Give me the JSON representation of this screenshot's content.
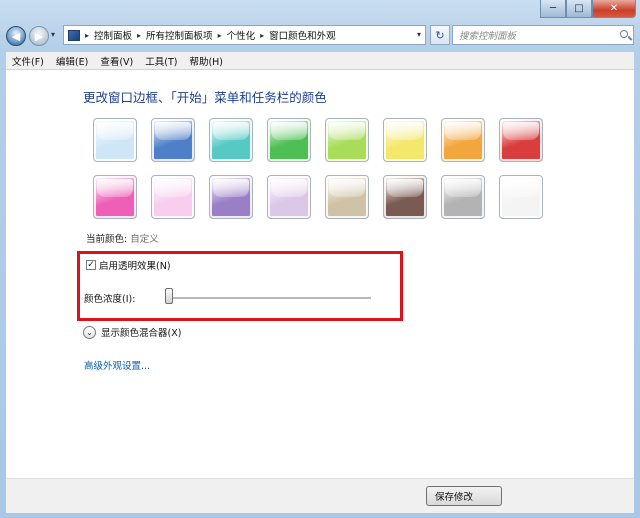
{
  "caption": {
    "minimize": "─",
    "maximize": "□",
    "close": "✕"
  },
  "nav": {
    "back": "◀",
    "forward": "▶",
    "history": "▾",
    "breadcrumbs": [
      "控制面板",
      "所有控制面板项",
      "个性化",
      "窗口颜色和外观"
    ],
    "breadcrumb_sep": "▸",
    "dropdown": "▾",
    "refresh": "↻",
    "search_placeholder": "搜索控制面板"
  },
  "menu": [
    "文件(F)",
    "编辑(E)",
    "查看(V)",
    "工具(T)",
    "帮助(H)"
  ],
  "page_title": "更改窗口边框、「开始」菜单和任务栏的颜色",
  "swatches": [
    {
      "name": "sky",
      "color": "#cfe6f7"
    },
    {
      "name": "twilight",
      "color": "#4e7fc8"
    },
    {
      "name": "sea",
      "color": "#57c9c4"
    },
    {
      "name": "leaf",
      "color": "#4fbf55"
    },
    {
      "name": "lime",
      "color": "#a9dc5a"
    },
    {
      "name": "lemon",
      "color": "#f4e86c"
    },
    {
      "name": "pumpkin",
      "color": "#f3a640"
    },
    {
      "name": "ruby",
      "color": "#d93d3d"
    },
    {
      "name": "fuchsia",
      "color": "#ee5fb7"
    },
    {
      "name": "blush",
      "color": "#f8cdee"
    },
    {
      "name": "violet",
      "color": "#9b7fc6"
    },
    {
      "name": "lavender",
      "color": "#dcc7e8"
    },
    {
      "name": "taupe",
      "color": "#cfc2a6"
    },
    {
      "name": "chocolate",
      "color": "#7a5a52"
    },
    {
      "name": "slate",
      "color": "#b3b3b3"
    },
    {
      "name": "frost",
      "color": "#f4f4f4"
    }
  ],
  "current_color_label": "当前颜色:",
  "current_color_value": "自定义",
  "transparency": {
    "label": "启用透明效果(N)",
    "checked": true,
    "mark": "✓"
  },
  "intensity": {
    "label": "颜色浓度(I):",
    "value": 0
  },
  "mixer": {
    "icon": "⌄",
    "label": "显示颜色混合器(X)"
  },
  "advanced_link": "高级外观设置...",
  "save_button": "保存修改",
  "accent_red": "#d8131b"
}
